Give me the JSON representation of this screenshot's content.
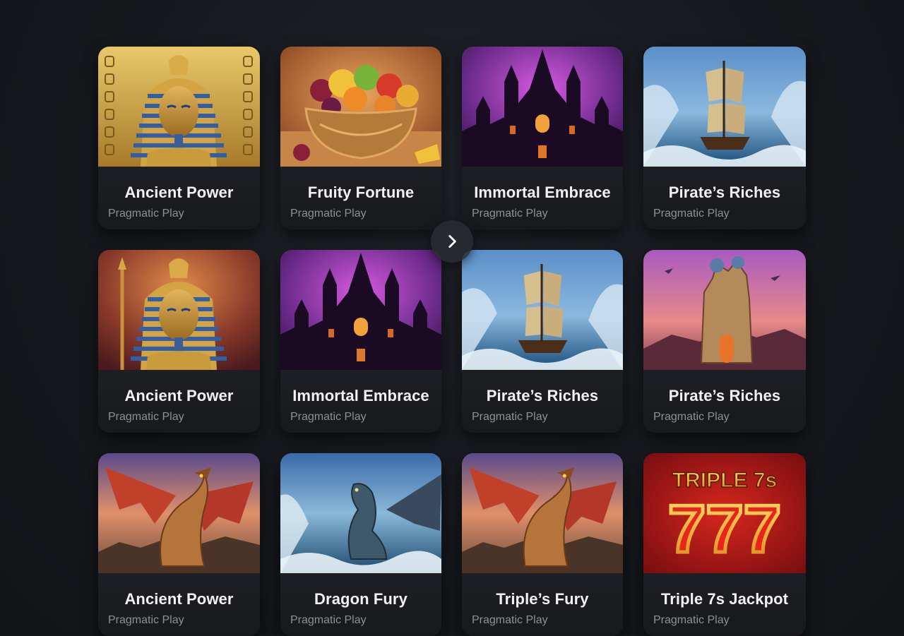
{
  "games": [
    {
      "title": "Ancient Power",
      "provider": "Pragmatic Play",
      "art": "pharaoh-gold"
    },
    {
      "title": "Fruity Fortune",
      "provider": "Pragmatic Play",
      "art": "fruit-bowl"
    },
    {
      "title": "Immortal Embrace",
      "provider": "Pragmatic Play",
      "art": "castle"
    },
    {
      "title": "Pirate’s Riches",
      "provider": "Pragmatic Play",
      "art": "pirate-ship"
    },
    {
      "title": "Ancient Power",
      "provider": "Pragmatic Play",
      "art": "pharaoh-red"
    },
    {
      "title": "Immortal Embrace",
      "provider": "Pragmatic Play",
      "art": "castle"
    },
    {
      "title": "Pirate’s Riches",
      "provider": "Pragmatic Play",
      "art": "pirate-ship"
    },
    {
      "title": "Pirate’s Riches",
      "provider": "Pragmatic Play",
      "art": "fantasy-tower"
    },
    {
      "title": "Ancient Power",
      "provider": "Pragmatic Play",
      "art": "dragon-red"
    },
    {
      "title": "Dragon Fury",
      "provider": "Pragmatic Play",
      "art": "dragon-sea"
    },
    {
      "title": "Triple’s Fury",
      "provider": "Pragmatic Play",
      "art": "dragon-red"
    },
    {
      "title": "Triple 7s Jackpot",
      "provider": "Pragmatic Play",
      "art": "triple-sevens",
      "art_text": {
        "top": "TRIPLE 7s",
        "main": "777"
      }
    }
  ],
  "next_button": {
    "icon": "chevron-right-icon"
  }
}
